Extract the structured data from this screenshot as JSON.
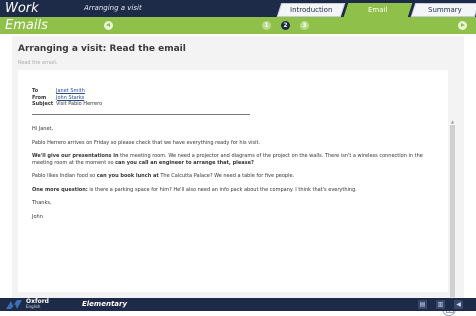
{
  "header": {
    "app_title": "Work",
    "subtitle": "Arranging a visit",
    "tabs": [
      {
        "label": "Introduction",
        "active": false
      },
      {
        "label": "Email",
        "active": true
      },
      {
        "label": "Summary",
        "active": false
      }
    ]
  },
  "section": {
    "title": "Emails",
    "pager": [
      "1",
      "2",
      "3"
    ],
    "current_page": "2"
  },
  "card": {
    "title": "Arranging a visit: Read the email",
    "instruction": "Read the email."
  },
  "email": {
    "to_label": "To",
    "to": "Janet Smith",
    "from_label": "From",
    "from": "John Starks",
    "subject_label": "Subject",
    "subject": "Visit Pablo Herrero",
    "greeting": "Hi Janet,",
    "p1": "Pablo Herrero arrives on Friday so please check that we have everything ready for his visit.",
    "p2_bold1": "We'll give our presentations in",
    "p2_text1": " the meeting room. We need a projector and diagrams of the project on the walls. There isn't a wireless connection in the meeting room at the moment so ",
    "p2_bold2": "can you call an engineer to arrange that, please?",
    "p3_text1": "Pablo likes Indian food so ",
    "p3_bold1": "can you book lunch at",
    "p3_text2": " The Calcutta Palace? We need a table for five people.",
    "p4_bold1": "One more question:",
    "p4_text1": " is there a parking space for him? He'll also need an info pack about the company. I think that's everything.",
    "thanks": "Thanks,",
    "signoff": "John"
  },
  "footer": {
    "brand": "Oxford",
    "brand_sub": "English",
    "level": "Elementary"
  },
  "colors": {
    "navy": "#1d2a48",
    "green": "#8ec04a"
  },
  "icons": [
    "prev-arrow-icon",
    "next-arrow-icon",
    "mail-icon",
    "notes-icon",
    "book-icon",
    "sound-icon"
  ]
}
